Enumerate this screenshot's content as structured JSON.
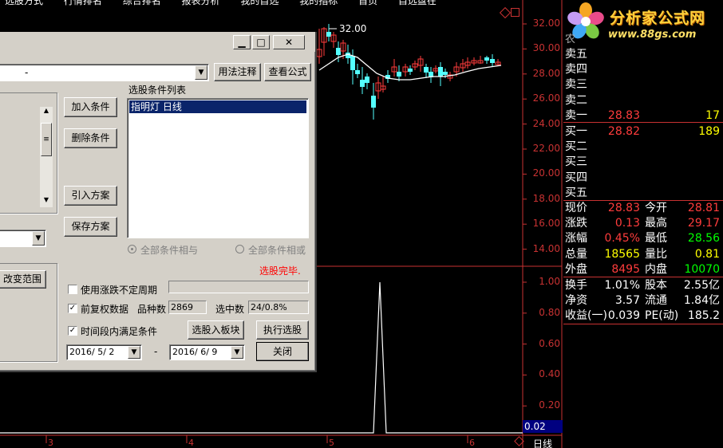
{
  "top_menu": [
    "选股方式",
    "行情排名",
    "综合排名",
    "报表分析",
    "我的自选",
    "我的指标",
    "首页",
    "自选盘在"
  ],
  "axis": {
    "price_ticks": [
      "32.00",
      "30.00",
      "28.00",
      "26.00",
      "24.00",
      "22.00",
      "20.00",
      "18.00",
      "16.00",
      "14.00"
    ],
    "indicator_ticks": [
      "1.00",
      "0.80",
      "0.60",
      "0.40",
      "0.20"
    ],
    "current_indicator": "0.02",
    "high_marker": "32.00",
    "time_ticks": [
      "3",
      "4",
      "5",
      "6"
    ],
    "period_label": "日线"
  },
  "logo": {
    "title": "分析家公式网",
    "url": "www.88gs.com"
  },
  "quote": {
    "sell": [
      {
        "label": "卖五",
        "price": "",
        "vol": ""
      },
      {
        "label": "卖四",
        "price": "",
        "vol": ""
      },
      {
        "label": "卖三",
        "price": "",
        "vol": ""
      },
      {
        "label": "卖二",
        "price": "",
        "vol": ""
      },
      {
        "label": "卖一",
        "price": "28.83",
        "vol": "17"
      }
    ],
    "buy": [
      {
        "label": "买一",
        "price": "28.82",
        "vol": "189"
      },
      {
        "label": "买二",
        "price": "",
        "vol": ""
      },
      {
        "label": "买三",
        "price": "",
        "vol": ""
      },
      {
        "label": "买四",
        "price": "",
        "vol": ""
      },
      {
        "label": "买五",
        "price": "",
        "vol": ""
      }
    ],
    "stats": [
      {
        "l1": "现价",
        "v1": "28.83",
        "l2": "今开",
        "v2": "28.81"
      },
      {
        "l1": "涨跌",
        "v1": "0.13",
        "l2": "最高",
        "v2": "29.17"
      },
      {
        "l1": "涨幅",
        "v1": "0.45%",
        "l2": "最低",
        "v2": "28.56"
      },
      {
        "l1": "总量",
        "v1": "18565",
        "l2": "量比",
        "v2": "0.81"
      },
      {
        "l1": "外盘",
        "v1": "8495",
        "l2": "内盘",
        "v2": "10070"
      }
    ],
    "fund": [
      {
        "l1": "换手",
        "v1": "1.01%",
        "l2": "股本",
        "v2": "2.55亿"
      },
      {
        "l1": "净资",
        "v1": "3.57",
        "l2": "流通",
        "v2": "1.84亿"
      },
      {
        "l1": "收益(一)",
        "v1": "0.039",
        "l2": "PE(动)",
        "v2": "185.2"
      }
    ],
    "header_tag": "农"
  },
  "colors": {
    "accent_red": "#c83232",
    "up": "#ff3c3c",
    "down": "#54ffff",
    "vol": "#ffff00",
    "ma": "#ffffff"
  },
  "dialog": {
    "title_buttons": {
      "min": "▁",
      "max": "□",
      "close": "✕"
    },
    "formula_value": "-",
    "help_button": "用法注释",
    "view_formula_button": "查看公式",
    "conditions_header": "选股条件列表",
    "conditions": [
      "指明灯  日线"
    ],
    "add_condition": "加入条件",
    "delete_condition": "删除条件",
    "import_plan": "引入方案",
    "save_plan": "保存方案",
    "radio_and": "全部条件相与",
    "radio_or": "全部条件相或",
    "status_done": "选股完毕.",
    "change_range": "改变范围",
    "use_period": "使用涨跌不定周期",
    "restore_data": "前复权数据",
    "count_label": "品种数",
    "count_value": "2869",
    "hit_label": "选中数",
    "hit_value": "24/0.8%",
    "time_condition": "时间段内满足条件",
    "to_block": "选股入板块",
    "execute": "执行选股",
    "close": "关闭",
    "date_from": "2016/ 5/ 2",
    "date_to": "2016/ 6/ 9",
    "date_sep": "-",
    "use_period_checked": false,
    "restore_checked": true,
    "time_checked": true
  }
}
